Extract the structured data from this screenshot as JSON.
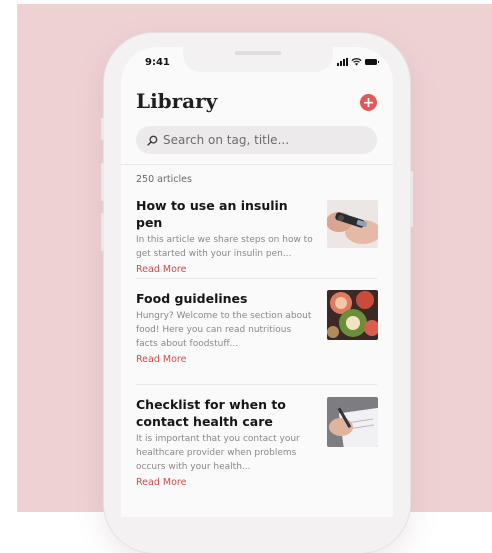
{
  "status_bar": {
    "time": "9:41"
  },
  "header": {
    "title": "Library",
    "add_icon": "plus-icon"
  },
  "search": {
    "placeholder": "Search on tag, title...",
    "icon": "search-icon"
  },
  "list": {
    "count_label": "250 articles",
    "articles": [
      {
        "title": "How to use an insulin pen",
        "body": "In this article we share steps on how to get started with your insulin pen...",
        "link": "Read More",
        "thumbnail": "insulin-pen-photo"
      },
      {
        "title": "Food guidelines",
        "body": "Hungry? Welcome to the section about food! Here you can read nutritious facts about foodstuff...",
        "link": "Read More",
        "thumbnail": "food-photo"
      },
      {
        "title": "Checklist for when to contact health care",
        "body": "It is important that you contact your healthcare provider when problems occurs with your health...",
        "link": "Read More",
        "thumbnail": "writing-photo"
      }
    ]
  },
  "colors": {
    "background": "#eed2d3",
    "accent": "#e05959",
    "link": "#d24a4d",
    "screen": "#fbfafa"
  }
}
